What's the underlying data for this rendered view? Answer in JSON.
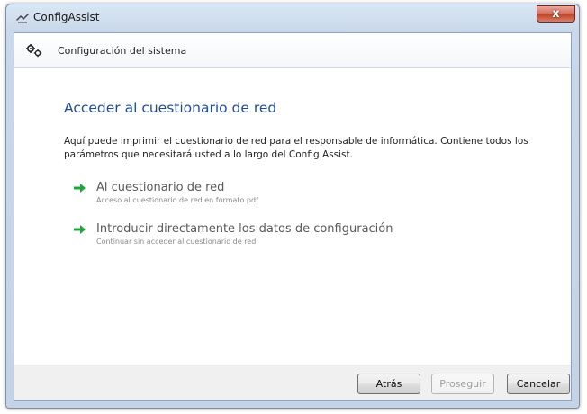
{
  "window": {
    "title": "ConfigAssist",
    "close_label": "x"
  },
  "header": {
    "icon": "gears-icon",
    "text": "Configuración del sistema"
  },
  "content": {
    "title": "Acceder al cuestionario de red",
    "description": "Aquí puede imprimir el cuestionario de red para el responsable de informática. Contiene todos los parámetros que necesitará usted a lo largo del Config Assist.",
    "options": [
      {
        "icon": "green-arrow-icon",
        "title": "Al cuestionario de red",
        "subtitle": "Acceso al cuestionario de red en formato pdf"
      },
      {
        "icon": "green-arrow-icon",
        "title": "Introducir directamente los datos de configuración",
        "subtitle": "Continuar sin acceder al cuestionario de red"
      }
    ],
    "arrow_color": "#1aa83a",
    "title_color": "#1f4b9c"
  },
  "footer": {
    "back_label": "Atrás",
    "next_label": "Proseguir",
    "next_enabled": false,
    "cancel_label": "Cancelar"
  }
}
